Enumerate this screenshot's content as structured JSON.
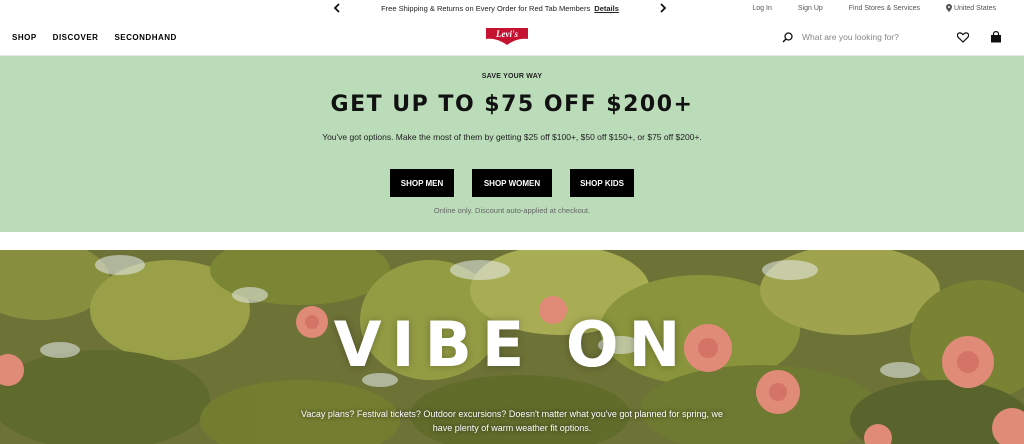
{
  "colors": {
    "banner_bg": "#bbdcb9",
    "brand_red": "#c41230",
    "cta_bg": "#000000",
    "hero_foliage": "#6d7237",
    "flower_pink": "#e08a78"
  },
  "utility_bar": {
    "prev_icon": "chevron-left-icon",
    "next_icon": "chevron-right-icon",
    "promo_text": "Free Shipping & Returns on Every Order for Red Tab Members",
    "promo_link": "Details",
    "links": {
      "login": "Log In",
      "signup": "Sign Up",
      "stores": "Find Stores & Services",
      "location": "United States"
    },
    "location_icon": "map-pin-icon"
  },
  "nav": {
    "items": [
      "SHOP",
      "DISCOVER",
      "SECONDHAND"
    ],
    "logo_text": "Levi's",
    "search_placeholder": "What are you looking for?",
    "icons": [
      "search-icon",
      "heart-icon",
      "shopping-bag-icon"
    ]
  },
  "promo": {
    "eyebrow": "SAVE YOUR WAY",
    "headline": "GET UP TO $75 OFF $200+",
    "description": "You've got options. Make the most of them by getting $25 off $100+, $50 off $150+, or $75 off $200+.",
    "buttons": [
      "SHOP MEN",
      "SHOP WOMEN",
      "SHOP KIDS"
    ],
    "fine_print": "Online only. Discount auto-applied at checkout."
  },
  "hero": {
    "title": "VIBE ON",
    "copy": "Vacay plans? Festival tickets? Outdoor excursions? Doesn't matter what you've got planned for spring, we have plenty of warm weather fit options."
  }
}
